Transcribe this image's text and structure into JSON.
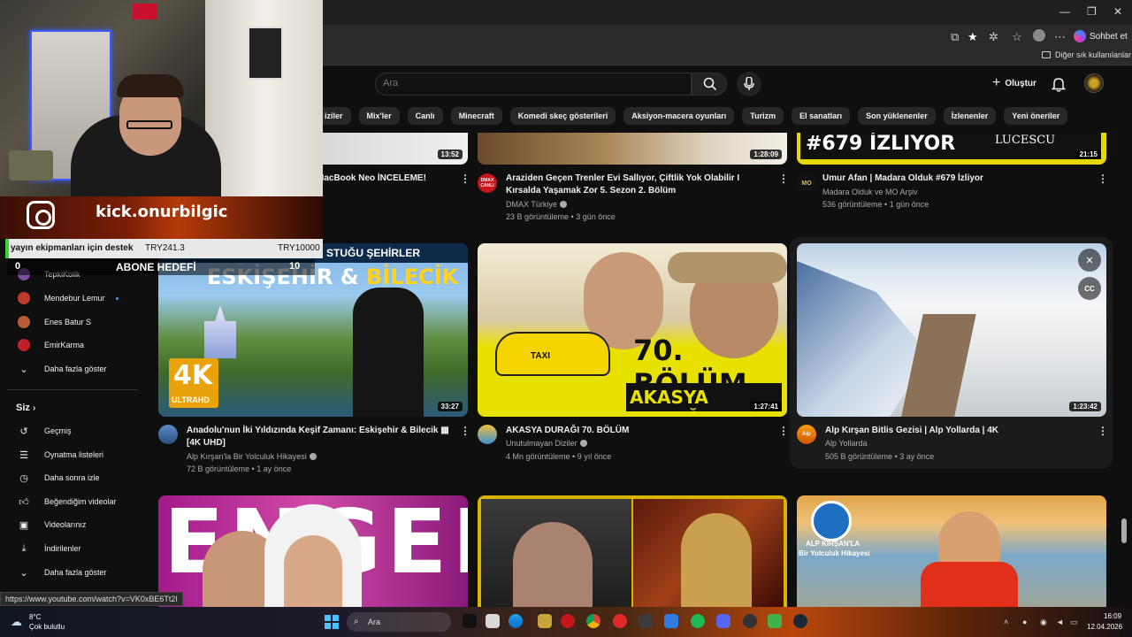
{
  "browser": {
    "sohbet_label": "Sohbet et",
    "bookmarks_label": "Diğer sık kullanılanlar",
    "status_url": "https://www.youtube.com/watch?v=VK0xBE6Tt2I"
  },
  "header": {
    "search_placeholder": "Ara",
    "create_label": "Oluştur"
  },
  "chips": [
    "iziler",
    "Mix'ler",
    "Canlı",
    "Minecraft",
    "Komedi skeç gösterileri",
    "Aksiyon-macera oyunları",
    "Turizm",
    "El sanatları",
    "Son yüklenenler",
    "İzlenenler",
    "Yeni öneriler"
  ],
  "sidebar": {
    "subscriptions": [
      {
        "label": "TepkiKolik",
        "color": "#7a4e9b"
      },
      {
        "label": "Mendebur Lemur",
        "color": "#c0392b",
        "live": true
      },
      {
        "label": "Enes Batur S",
        "color": "#b85c38"
      },
      {
        "label": "EmirKarma",
        "color": "#c0202a"
      }
    ],
    "show_more": "Daha fazla göster",
    "you_label": "Siz",
    "you_items": [
      {
        "icon": "history-icon",
        "label": "Geçmiş"
      },
      {
        "icon": "playlist-icon",
        "label": "Oynatma listeleri"
      },
      {
        "icon": "clock-icon",
        "label": "Daha sonra izle"
      },
      {
        "icon": "thumbs-up-icon",
        "label": "Beğendiğim videolar"
      },
      {
        "icon": "video-icon",
        "label": "Videolarınız"
      },
      {
        "icon": "download-icon",
        "label": "İndirilenler"
      },
      {
        "icon": "chevron-down-icon",
        "label": "Daha fazla göster"
      }
    ]
  },
  "overlay": {
    "kick_handle": "kick.onurbilgic",
    "donation_label": "yayın ekipmanları için destek",
    "donation_current": "TRY241.3",
    "donation_goal": "TRY10000",
    "sub_current": "0",
    "sub_label": "ABONE HEDEFİ",
    "sub_goal": "10"
  },
  "videos_row1": [
    {
      "title": "MacBook Neo İNCELEME!",
      "duration": "13:52"
    },
    {
      "title": "Araziden Geçen Trenler Evi Sallıyor, Çiftlik Yok Olabilir I Kırsalda Yaşamak Zor 5. Sezon 2. Bölüm",
      "channel": "DMAX Türkiye",
      "meta": "23 B görüntüleme • 3 gün önce",
      "duration": "1:28:09",
      "avatar_text": "DMAX CANLI"
    },
    {
      "title": "Umur Afan | Madara Olduk #679 İzliyor",
      "channel": "Madara Olduk ve MO Arşiv",
      "meta": "536 görüntüleme • 1 gün önce",
      "duration": "21:15",
      "thumb_text": "#679 İZLIYOR",
      "thumb_brand": "LUCESCU",
      "avatar_text": "MO"
    }
  ],
  "videos_row2": [
    {
      "title_line1": "Anadolu'nun İki Yıldızında Keşif Zamanı: Eskişehir & Bilecik",
      "title_line2": "[4K UHD]",
      "channel": "Alp Kırşan'la Bir Yolculuk Hikayesi",
      "meta": "72 B görüntüleme • 1 ay önce",
      "duration": "33:27",
      "thumb_top": "STUĞU ŞEHİRLER",
      "thumb_city1": "ESKİŞEHİR",
      "thumb_amp": "&",
      "thumb_city2": "BİLECİK",
      "badge_4k": "4K",
      "badge_uhd": "ULTRAHD"
    },
    {
      "title": "AKASYA DURAĞI 70. BÖLÜM",
      "channel": "Unutulmayan Diziler",
      "meta": "4 Mn görüntüleme • 9 yıl önce",
      "duration": "1:27:41",
      "thumb_big": "70. BÖLÜM",
      "thumb_sub": "AKASYA DURAĞI",
      "taxi": "TAXI"
    },
    {
      "title": "Alp Kırşan Bitlis Gezisi | Alp Yollarda | 4K",
      "channel": "Alp Yollarda",
      "meta": "505 B görüntüleme • 3 ay önce",
      "duration": "1:23:42",
      "cc": "CC",
      "avatar_text": "Alp"
    }
  ],
  "videos_row3": [
    {
      "thumb_text": "ENGEL"
    },
    {
      "thumb_text": ""
    },
    {
      "badge_line1": "ALP KIRŞAN'LA",
      "badge_line2": "Bir Yolculuk Hikayesi"
    }
  ],
  "taskbar": {
    "temp": "8°C",
    "weather": "Çok bulutlu",
    "search": "Ara",
    "time": "16:09",
    "date": "12.04.2026"
  }
}
